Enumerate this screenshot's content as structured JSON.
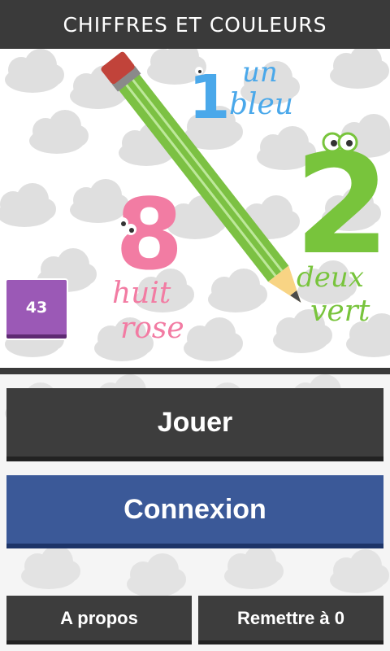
{
  "app": {
    "title": "CHIFFRES ET COULEURS"
  },
  "hero": {
    "n1": {
      "digit": "1",
      "word": "un",
      "color_name": "bleu",
      "color": "#4aa8ea"
    },
    "n2": {
      "digit": "2",
      "word": "deux",
      "color_name": "vert",
      "color": "#78c43c"
    },
    "n8": {
      "digit": "8",
      "word": "huit",
      "color_name": "rose",
      "color": "#f27ca3"
    }
  },
  "badge": {
    "value": "43",
    "color": "#9b59b6"
  },
  "buttons": {
    "play": "Jouer",
    "login": "Connexion",
    "about": "A propos",
    "reset": "Remettre à 0"
  },
  "colors": {
    "header": "#3a3a3a",
    "button_dark": "#3d3d3d",
    "button_facebook": "#3b5998",
    "pencil": "#7cc143"
  },
  "icons": [
    "pencil-illustration",
    "cloud-pattern",
    "eyes-icon"
  ]
}
